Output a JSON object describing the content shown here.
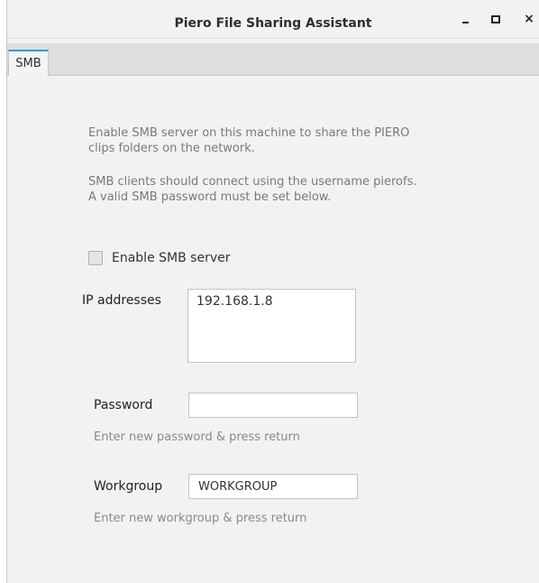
{
  "window": {
    "title": "Piero File Sharing Assistant",
    "controls": {
      "minimize": "minimize-icon",
      "maximize": "maximize-icon",
      "close": "close-icon"
    }
  },
  "tabs": [
    {
      "label": "SMB",
      "selected": true
    }
  ],
  "smb": {
    "description_line1": "Enable SMB server on this machine to share the PIERO",
    "description_line2": "clips folders on the network.",
    "description_line3": "SMB clients should connect using the username pierofs.",
    "description_line4": "A valid SMB password must be set below.",
    "enable_label": "Enable SMB server",
    "enabled": false,
    "ip_label": "IP addresses",
    "ip_addresses": "192.168.1.8",
    "password_label": "Password",
    "password_value": "",
    "password_hint": "Enter new password & press return",
    "workgroup_label": "Workgroup",
    "workgroup_value": "WORKGROUP",
    "workgroup_hint": "Enter new workgroup & press return"
  },
  "colors": {
    "tab_accent": "#2f9bd6",
    "background": "#f2f2f2"
  }
}
